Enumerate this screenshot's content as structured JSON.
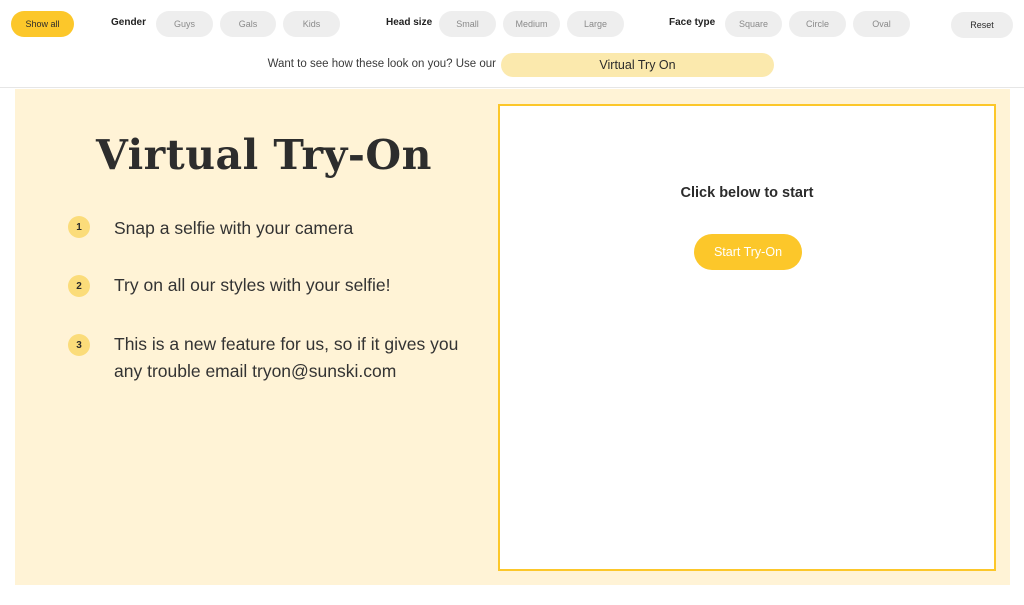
{
  "filters": {
    "show_all": "Show all",
    "gender": {
      "label": "Gender",
      "options": [
        "Guys",
        "Gals",
        "Kids"
      ]
    },
    "head_size": {
      "label": "Head size",
      "options": [
        "Small",
        "Medium",
        "Large"
      ]
    },
    "face_type": {
      "label": "Face type",
      "options": [
        "Square",
        "Circle",
        "Oval"
      ]
    },
    "reset": "Reset"
  },
  "promo": {
    "text": "Want to see how these look on you? Use our",
    "link": "Virtual Try On"
  },
  "intro": {
    "title": "Virtual Try-On",
    "steps": [
      {
        "number": "1",
        "text": "Snap a selfie with your camera"
      },
      {
        "number": "2",
        "text": "Try on all our styles with your selfie!"
      },
      {
        "number": "3",
        "text": "This is a new feature for us, so if it gives you any trouble email tryon@sunski.com"
      }
    ]
  },
  "tryon": {
    "heading": "Click below to start",
    "start_button": "Start Try-On"
  },
  "colors": {
    "accent": "#fcc72a",
    "panel_bg": "#fff3d6",
    "pill_bg": "#eeeeee",
    "promo_link_bg": "#fbe9ad"
  }
}
